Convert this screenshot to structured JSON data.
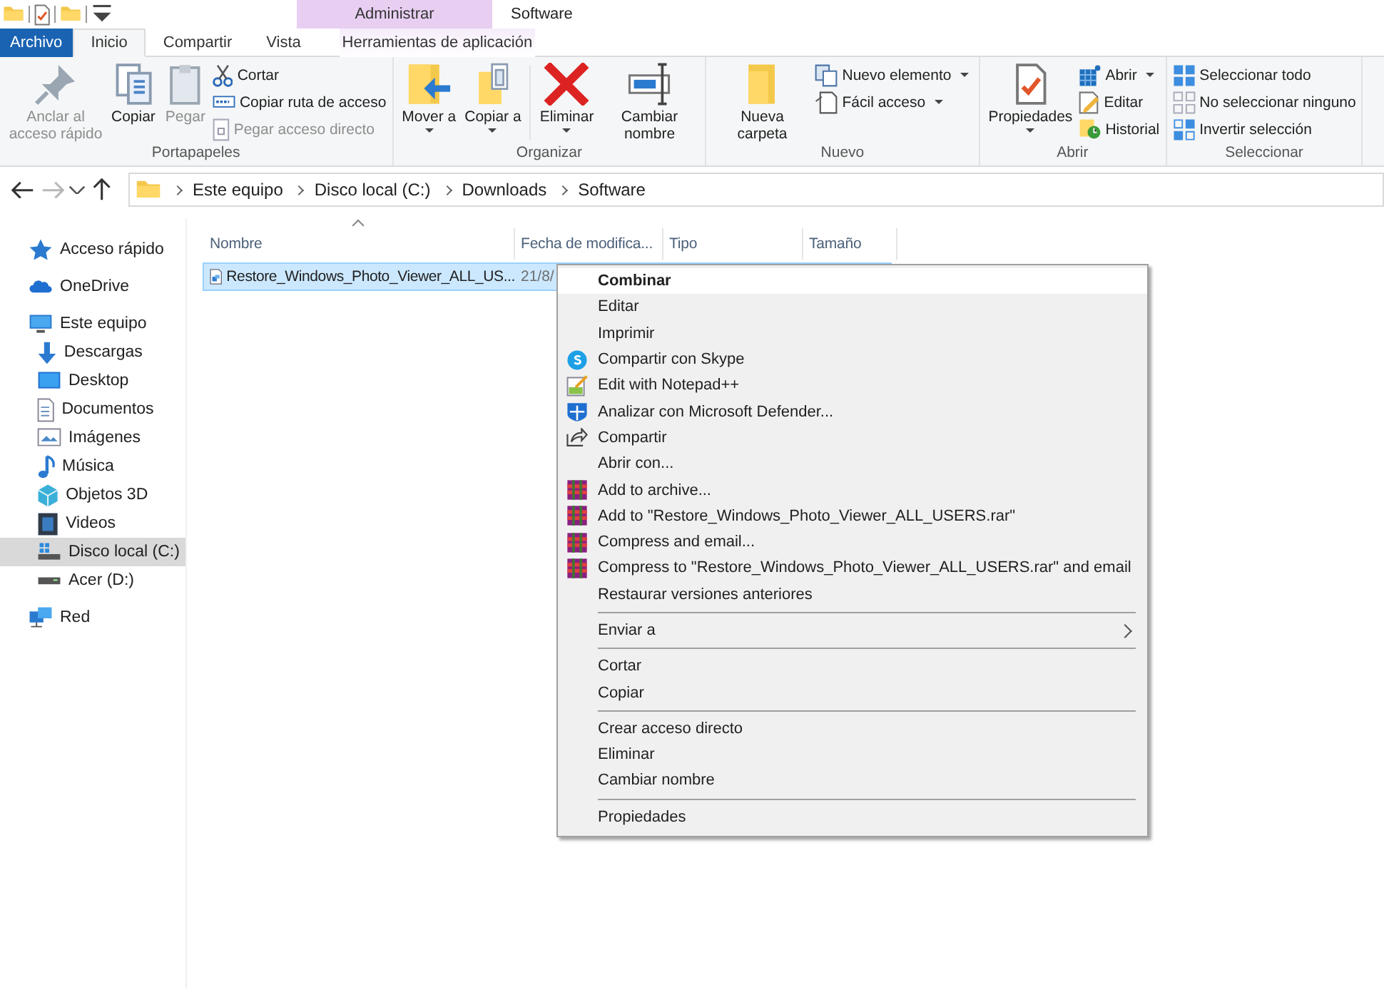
{
  "window": {
    "title": "Software",
    "contextual_header": "Administrar"
  },
  "quick_access_toolbar": [
    {
      "kind": "button"
    },
    {
      "kind": "button"
    },
    {
      "kind": "button"
    },
    {
      "kind": "button"
    }
  ],
  "tabs": [
    {
      "label": "Archivo",
      "kind": "file",
      "selected": false
    },
    {
      "label": "Inicio",
      "kind": "tab",
      "selected": true
    },
    {
      "label": "Compartir",
      "kind": "tab",
      "selected": false
    },
    {
      "label": "Vista",
      "kind": "tab",
      "selected": false
    },
    {
      "label": "Herramientas de aplicación",
      "kind": "contextual",
      "selected": false
    }
  ],
  "ribbon_groups": [
    {
      "label": "Portapapeles",
      "items": [
        {
          "kind": "large",
          "label": "Anclar al acceso rápido",
          "disabled": true,
          "dropdown": false
        },
        {
          "kind": "large",
          "label": "Copiar",
          "disabled": false,
          "dropdown": false
        },
        {
          "kind": "large",
          "label": "Pegar",
          "disabled": true,
          "dropdown": false
        },
        {
          "kind": "stack",
          "items": [
            {
              "label": "Cortar",
              "disabled": false,
              "dropdown": false
            },
            {
              "label": "Copiar ruta de acceso",
              "disabled": false,
              "dropdown": false
            },
            {
              "label": "Pegar acceso directo",
              "disabled": true,
              "dropdown": false
            }
          ]
        }
      ]
    },
    {
      "label": "Organizar",
      "items": [
        {
          "kind": "large",
          "label": "Mover a",
          "disabled": false,
          "dropdown": true
        },
        {
          "kind": "large",
          "label": "Copiar a",
          "disabled": false,
          "dropdown": true
        },
        {
          "kind": "divider"
        },
        {
          "kind": "large",
          "label": "Eliminar",
          "disabled": false,
          "dropdown": true
        },
        {
          "kind": "large",
          "label": "Cambiar nombre",
          "disabled": false,
          "dropdown": false
        }
      ]
    },
    {
      "label": "Nuevo",
      "items": [
        {
          "kind": "large",
          "label": "Nueva carpeta",
          "disabled": false,
          "dropdown": false
        },
        {
          "kind": "stack",
          "items": [
            {
              "label": "Nuevo elemento",
              "disabled": false,
              "dropdown": true
            },
            {
              "label": "Fácil acceso",
              "disabled": false,
              "dropdown": true
            }
          ]
        }
      ]
    },
    {
      "label": "Abrir",
      "items": [
        {
          "kind": "large",
          "label": "Propiedades",
          "disabled": false,
          "dropdown": true
        },
        {
          "kind": "stack",
          "items": [
            {
              "label": "Abrir",
              "disabled": false,
              "dropdown": true
            },
            {
              "label": "Editar",
              "disabled": false,
              "dropdown": false
            },
            {
              "label": "Historial",
              "disabled": false,
              "dropdown": false
            }
          ]
        }
      ]
    },
    {
      "label": "Seleccionar",
      "items": [
        {
          "kind": "stack",
          "items": [
            {
              "label": "Seleccionar todo",
              "disabled": false,
              "dropdown": false
            },
            {
              "label": "No seleccionar ninguno",
              "disabled": false,
              "dropdown": false
            },
            {
              "label": "Invertir selección",
              "disabled": false,
              "dropdown": false
            }
          ]
        }
      ]
    }
  ],
  "navigation": {
    "back_disabled": false,
    "forward_disabled": true
  },
  "breadcrumb": [
    "Este equipo",
    "Disco local (C:)",
    "Downloads",
    "Software"
  ],
  "sidebar": {
    "items": [
      {
        "label": "Acceso rápido",
        "selected": false
      },
      {
        "label": "OneDrive",
        "selected": false
      },
      {
        "label": "Este equipo",
        "selected": false,
        "children": [
          {
            "label": "Descargas",
            "selected": false
          },
          {
            "label": "Desktop",
            "selected": false
          },
          {
            "label": "Documentos",
            "selected": false
          },
          {
            "label": "Imágenes",
            "selected": false
          },
          {
            "label": "Música",
            "selected": false
          },
          {
            "label": "Objetos 3D",
            "selected": false
          },
          {
            "label": "Videos",
            "selected": false
          },
          {
            "label": "Disco local (C:)",
            "selected": true
          },
          {
            "label": "Acer (D:)",
            "selected": false
          }
        ]
      },
      {
        "label": "Red",
        "selected": false
      }
    ]
  },
  "table": {
    "columns": [
      "Nombre",
      "Fecha de modifica...",
      "Tipo",
      "Tamaño"
    ],
    "rows": [
      {
        "name": "Restore_Windows_Photo_Viewer_ALL_US...",
        "date": "21/8/",
        "selected": true
      }
    ]
  },
  "context_menu": [
    {
      "kind": "item",
      "label": "Combinar",
      "default": true,
      "submenu": false
    },
    {
      "kind": "item",
      "label": "Editar",
      "default": false,
      "submenu": false
    },
    {
      "kind": "item",
      "label": "Imprimir",
      "default": false,
      "submenu": false
    },
    {
      "kind": "item",
      "label": "Compartir con Skype",
      "default": false,
      "submenu": false
    },
    {
      "kind": "item",
      "label": "Edit with Notepad++",
      "default": false,
      "submenu": false
    },
    {
      "kind": "item",
      "label": "Analizar con Microsoft Defender...",
      "default": false,
      "submenu": false
    },
    {
      "kind": "item",
      "label": "Compartir",
      "default": false,
      "submenu": false
    },
    {
      "kind": "item",
      "label": "Abrir con...",
      "default": false,
      "submenu": false
    },
    {
      "kind": "item",
      "label": "Add to archive...",
      "default": false,
      "submenu": false
    },
    {
      "kind": "item",
      "label": "Add to \"Restore_Windows_Photo_Viewer_ALL_USERS.rar\"",
      "default": false,
      "submenu": false
    },
    {
      "kind": "item",
      "label": "Compress and email...",
      "default": false,
      "submenu": false
    },
    {
      "kind": "item",
      "label": "Compress to \"Restore_Windows_Photo_Viewer_ALL_USERS.rar\" and email",
      "default": false,
      "submenu": false
    },
    {
      "kind": "item",
      "label": "Restaurar versiones anteriores",
      "default": false,
      "submenu": false
    },
    {
      "kind": "separator"
    },
    {
      "kind": "item",
      "label": "Enviar a",
      "default": false,
      "submenu": true
    },
    {
      "kind": "separator"
    },
    {
      "kind": "item",
      "label": "Cortar",
      "default": false,
      "submenu": false
    },
    {
      "kind": "item",
      "label": "Copiar",
      "default": false,
      "submenu": false
    },
    {
      "kind": "separator"
    },
    {
      "kind": "item",
      "label": "Crear acceso directo",
      "default": false,
      "submenu": false
    },
    {
      "kind": "item",
      "label": "Eliminar",
      "default": false,
      "submenu": false
    },
    {
      "kind": "item",
      "label": "Cambiar nombre",
      "default": false,
      "submenu": false
    },
    {
      "kind": "separator"
    },
    {
      "kind": "item",
      "label": "Propiedades",
      "default": false,
      "submenu": false
    }
  ]
}
